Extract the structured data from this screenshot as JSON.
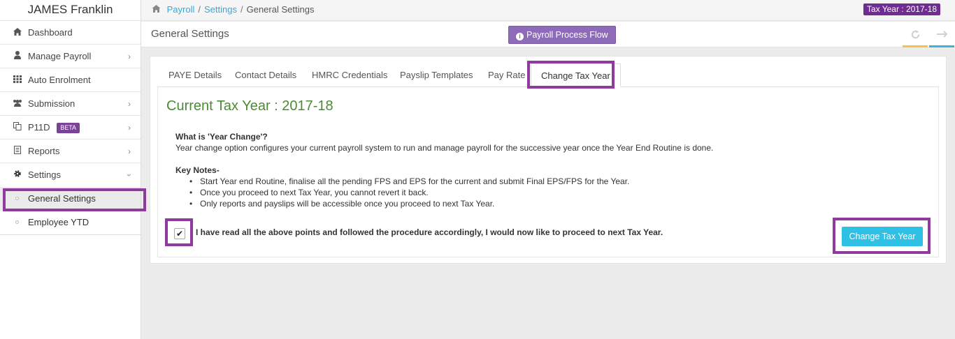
{
  "sidebar": {
    "user_name": "JAMES Franklin",
    "items": [
      {
        "label": "Dashboard",
        "icon": "home-icon"
      },
      {
        "label": "Manage Payroll",
        "icon": "user-icon"
      },
      {
        "label": "Auto Enrolment",
        "icon": "grid-icon"
      },
      {
        "label": "Submission",
        "icon": "users-icon"
      },
      {
        "label": "P11D",
        "icon": "copy-icon",
        "badge": "BETA"
      },
      {
        "label": "Reports",
        "icon": "file-icon"
      },
      {
        "label": "Settings",
        "icon": "gear-icon"
      }
    ],
    "settings_children": [
      {
        "label": "General Settings",
        "active": true
      },
      {
        "label": "Employee YTD",
        "active": false
      }
    ]
  },
  "topbar": {
    "breadcrumb": [
      "Payroll",
      "Settings",
      "General Settings"
    ],
    "tax_year_badge": "Tax Year : 2017-18"
  },
  "header": {
    "title": "General Settings",
    "flow_button": "Payroll Process Flow"
  },
  "tabs": [
    "PAYE Details",
    "Contact Details",
    "HMRC Credentials",
    "Payslip Templates",
    "Pay Rate",
    "Change Tax Year"
  ],
  "active_tab": "Change Tax Year",
  "content": {
    "current_tax_year": "Current Tax Year : 2017-18",
    "what_heading": "What is 'Year Change'?",
    "what_text": "Year change option configures your current payroll system to run and manage payroll for the successive year once the Year End Routine is done.",
    "key_notes_heading": "Key Notes-",
    "notes": [
      "Start Year end Routine, finalise all the pending FPS and EPS for the current and submit Final EPS/FPS for the Year.",
      "Once you proceed to next Tax Year, you cannot revert it back.",
      "Only reports and payslips will be accessible once you proceed to next Tax Year."
    ],
    "agree_text": "I have read all the above points and followed the procedure accordingly, I would now like to proceed to next Tax Year.",
    "agree_checked": true,
    "change_button": "Change Tax Year"
  },
  "colors": {
    "accent_purple": "#6f2c91",
    "highlight": "#8e3b9d",
    "button_blue": "#2fc0e6",
    "title_green": "#4a8b34"
  }
}
